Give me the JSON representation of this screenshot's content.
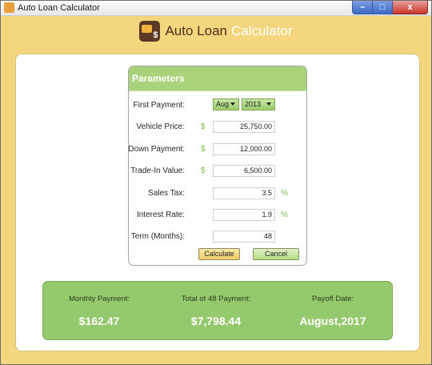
{
  "window": {
    "title": "Auto Loan Calculator",
    "controls": {
      "minimize": "–",
      "maximize": "□",
      "close": "x"
    }
  },
  "header": {
    "title_main": "Auto Loan",
    "title_accent": "Calculator"
  },
  "parameters": {
    "heading": "Parameters",
    "first_payment": {
      "label": "First Payment:",
      "month": "Aug",
      "year": "2013"
    },
    "vehicle_price": {
      "label": "Vehicle Price:",
      "currency": "$",
      "value": "25,750.00"
    },
    "down_payment": {
      "label": "Down Payment:",
      "currency": "$",
      "value": "12,000.00"
    },
    "trade_in_value": {
      "label": "Trade-In Value:",
      "currency": "$",
      "value": "6,500.00"
    },
    "sales_tax": {
      "label": "Sales Tax:",
      "value": "3.5",
      "unit": "%"
    },
    "interest_rate": {
      "label": "Interest Rate:",
      "value": "1.9",
      "unit": "%"
    },
    "term_months": {
      "label": "Term (Months):",
      "value": "48"
    },
    "calculate_label": "Calculate",
    "cancel_label": "Cancel"
  },
  "results": {
    "monthly_payment": {
      "label": "Monthly Payment:",
      "value": "$162.47"
    },
    "total_payment": {
      "label": "Total of 48 Payment:",
      "value": "$7,798.44"
    },
    "payoff_date": {
      "label": "Payoff Date:",
      "value": "August,2017"
    }
  },
  "colors": {
    "window_bg": "#f4d67e",
    "green_accent": "#a9d27b",
    "results_bg": "#95c96d",
    "title_text": "#4a2f1d"
  }
}
